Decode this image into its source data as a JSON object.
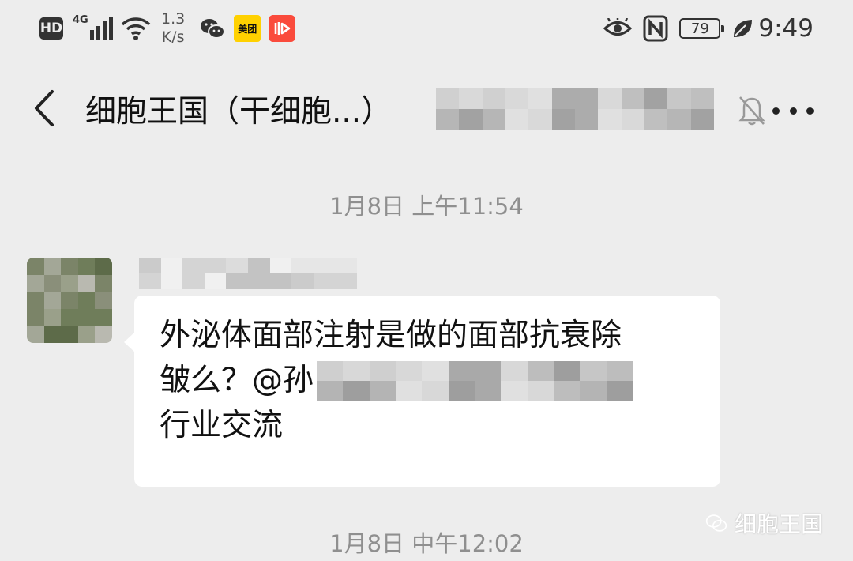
{
  "status_bar": {
    "hd_label": "HD",
    "network_label": "4G",
    "speed_value": "1.3",
    "speed_unit": "K/s",
    "meituan_label": "美团",
    "battery_level": "79",
    "time": "9:49"
  },
  "nav": {
    "title": "细胞王国（干细胞...）",
    "icons": [
      "back-arrow-icon",
      "mute-bell-icon",
      "more-icon"
    ]
  },
  "chat": {
    "timestamp_1": "1月8日 上午11:54",
    "timestamp_2": "1月8日 中午12:02",
    "message": {
      "line1": "外泌体面部注射是做的面部抗衰除",
      "line2_prefix": "皱么？@孙",
      "line3": "行业交流"
    }
  },
  "watermark": {
    "label": "细胞王国"
  },
  "colors": {
    "background": "#ededed",
    "bubble": "#ffffff",
    "timestamp": "#8f8f8f",
    "meituan": "#ffd100",
    "red_app": "#fa4b3c"
  }
}
